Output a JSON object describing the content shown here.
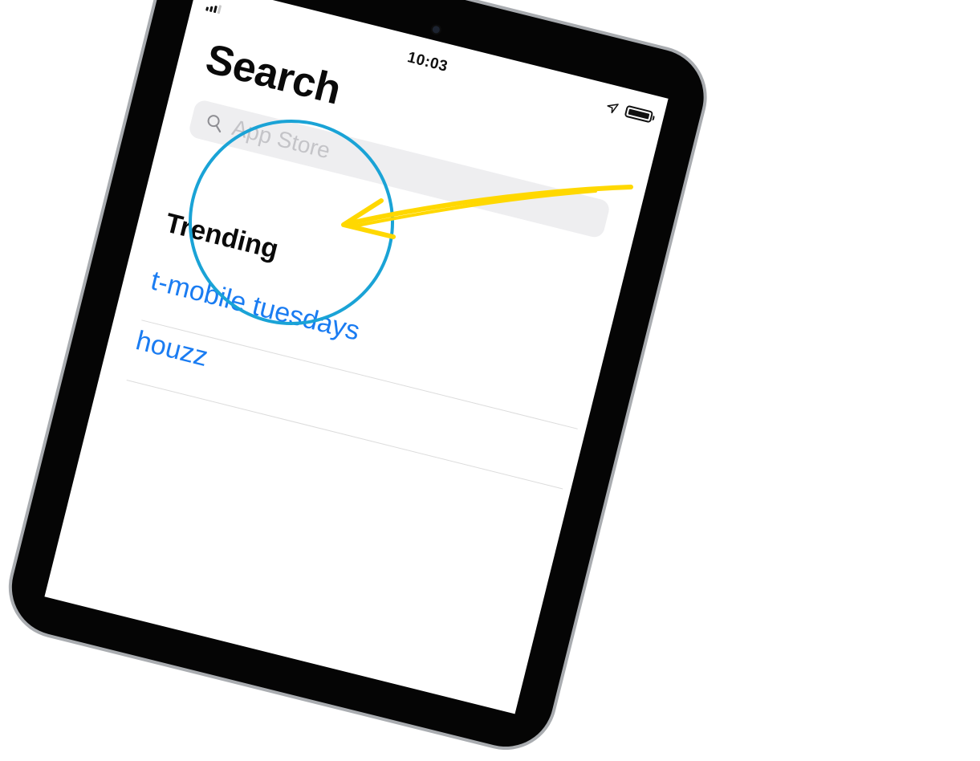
{
  "status_bar": {
    "time": "10:03"
  },
  "page": {
    "title": "Search",
    "search_placeholder": "App Store",
    "trending_title": "Trending",
    "trending_items": [
      {
        "label": "t-mobile tuesdays"
      },
      {
        "label": "houzz"
      }
    ]
  },
  "icons": {
    "search": "magnifier-icon",
    "location": "location-arrow-icon",
    "battery": "battery-icon",
    "signal": "signal-icon"
  },
  "colors": {
    "link_blue": "#1a7cf2",
    "highlight_circle": "#1aa3d6",
    "arrow_yellow": "#ffd800",
    "search_bg": "#eeeef0"
  }
}
